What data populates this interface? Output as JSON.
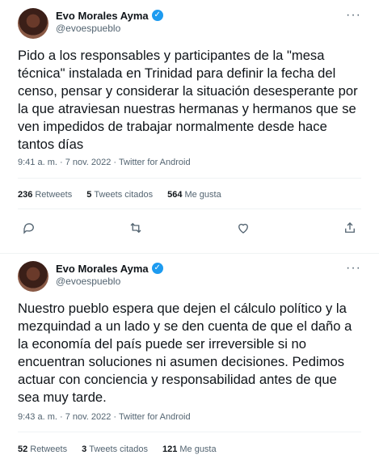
{
  "tweets": [
    {
      "author_name": "Evo Morales Ayma",
      "handle": "@evoespueblo",
      "text": "Pido a los responsables y participantes de la \"mesa técnica\" instalada en Trinidad para definir la fecha del censo, pensar y considerar la situación desesperante por la que atraviesan nuestras hermanas y hermanos que se ven impedidos de trabajar normalmente desde hace tantos días",
      "meta": "9:41 a. m. · 7 nov. 2022 · Twitter for Android",
      "retweets_count": "236",
      "retweets_label": "Retweets",
      "quotes_count": "5",
      "quotes_label": "Tweets citados",
      "likes_count": "564",
      "likes_label": "Me gusta"
    },
    {
      "author_name": "Evo Morales Ayma",
      "handle": "@evoespueblo",
      "text": "Nuestro pueblo espera que dejen el cálculo político y la mezquindad a un lado y se den cuenta de que el daño a la economía del país puede ser irreversible si no encuentran soluciones ni asumen decisiones. Pedimos actuar con conciencia y responsabilidad antes de que sea muy tarde.",
      "meta": "9:43 a. m. · 7 nov. 2022 · Twitter for Android",
      "retweets_count": "52",
      "retweets_label": "Retweets",
      "quotes_count": "3",
      "quotes_label": "Tweets citados",
      "likes_count": "121",
      "likes_label": "Me gusta"
    }
  ],
  "icons": {
    "verified": "verified-badge-icon",
    "more": "more-options-icon",
    "reply": "reply-icon",
    "retweet": "retweet-icon",
    "like": "heart-icon",
    "share": "share-icon"
  },
  "colors": {
    "verified": "#1d9bf0",
    "text": "#0f1419",
    "secondary": "#536471",
    "divider": "#eff3f4"
  }
}
